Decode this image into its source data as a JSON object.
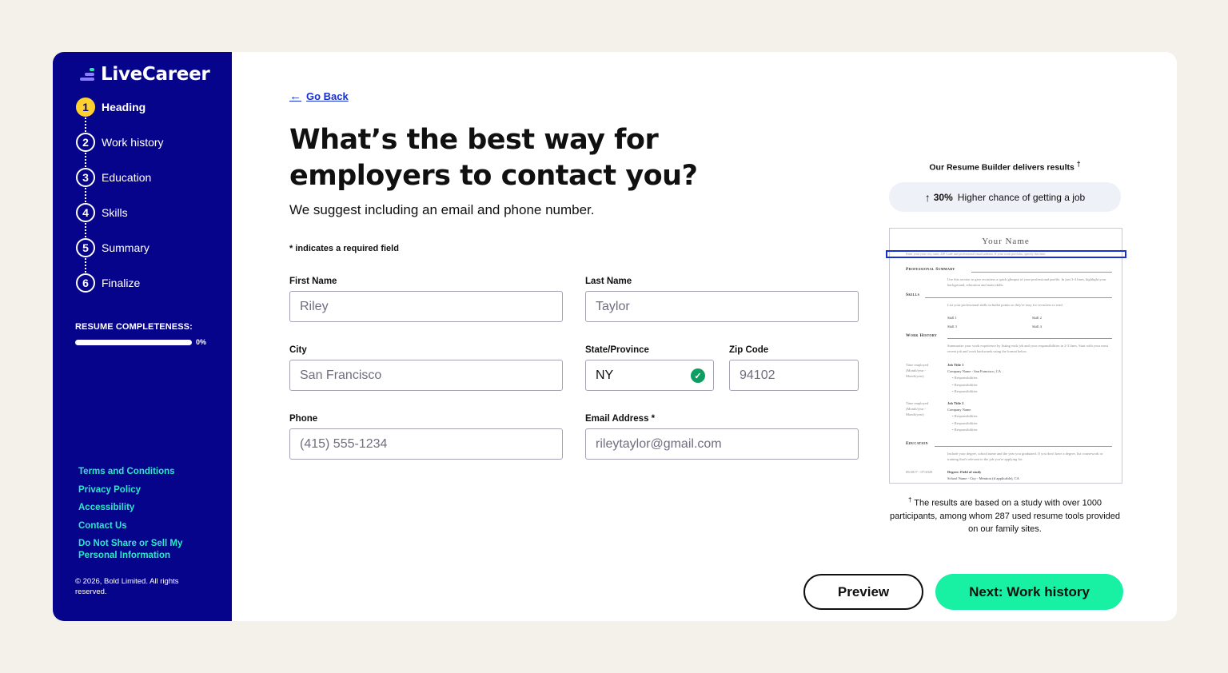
{
  "brand": {
    "name": "LiveCareer",
    "accent": "#2ce8a8",
    "sidebar_bg": "#07048c",
    "active_step_color": "#ffd12e"
  },
  "steps": [
    {
      "num": "1",
      "label": "Heading",
      "active": true
    },
    {
      "num": "2",
      "label": "Work history",
      "active": false
    },
    {
      "num": "3",
      "label": "Education",
      "active": false
    },
    {
      "num": "4",
      "label": "Skills",
      "active": false
    },
    {
      "num": "5",
      "label": "Summary",
      "active": false
    },
    {
      "num": "6",
      "label": "Finalize",
      "active": false
    }
  ],
  "completeness": {
    "label": "RESUME COMPLETENESS:",
    "value_pct": "0%",
    "value": 0
  },
  "footer": {
    "links": [
      "Terms and Conditions",
      "Privacy Policy",
      "Accessibility",
      "Contact Us",
      "Do Not Share or Sell My Personal Information"
    ],
    "copyright": "© 2026, Bold Limited. All rights reserved."
  },
  "nav": {
    "go_back": "Go Back"
  },
  "page": {
    "title": "What’s the best way for employers to contact you?",
    "subtitle": "We suggest including an email and phone number.",
    "required_note": "* indicates a required field"
  },
  "form": {
    "first_name": {
      "label": "First Name",
      "placeholder": "Riley"
    },
    "last_name": {
      "label": "Last Name",
      "placeholder": "Taylor"
    },
    "city": {
      "label": "City",
      "placeholder": "San Francisco"
    },
    "state": {
      "label": "State/Province",
      "value": "NY",
      "valid_icon": "check-circle-icon"
    },
    "zip": {
      "label": "Zip Code",
      "placeholder": "94102"
    },
    "phone": {
      "label": "Phone",
      "placeholder": "(415) 555-1234"
    },
    "email": {
      "label": "Email Address *",
      "placeholder": "rileytaylor@gmail.com"
    }
  },
  "results": {
    "title": "Our Resume Builder delivers results",
    "dagger": "†",
    "stat_value": "30%",
    "stat_text": "Higher chance of getting a job",
    "footnote": "The results are based on a study with over 1000 participants, among whom 287 used resume tools provided on our family sites."
  },
  "resume_preview": {
    "name": "Your Name",
    "contact": "Enter your your city, state, ZIP Code and professional email address. If your work portfolio, specify this here.",
    "sections": {
      "summary": "Professional Summary",
      "skills": "Skills",
      "work": "Work History",
      "education": "Education"
    },
    "summary_text": "Use this section to give recruiters a quick glimpse of your professional profile. In just 3-4 lines, highlight your background, education and main skills.",
    "skills_text": "List your professional skills in bullet points so they're easy for recruiters to read.",
    "skills": [
      "Skill 1",
      "Skill 2",
      "Skill 3",
      "Skill 4"
    ],
    "work_text": "Summarize your work experience by listing each job and your responsibilities in 2-3 lines. Start with your most recent job and work backwards using the format below.",
    "jobs": [
      {
        "dates": "Time employed (Month/year - Month/year)",
        "title": "Job Title 1",
        "company": "Company Name - San Francisco, CA",
        "items": [
          "Responsibilities",
          "Responsibilities",
          "Responsibilities"
        ]
      },
      {
        "dates": "Time employed (Month/year - Month/year)",
        "title": "Job Title 2",
        "company": "Company Name",
        "items": [
          "Responsibilities",
          "Responsibilities",
          "Responsibilities"
        ]
      }
    ],
    "education_text": "Include your degree, school name and the year you graduated. If you don't have a degree, list coursework or training that's relevant to the job you're applying for.",
    "edu_dates": "09/2017 - 07/2020",
    "edu_degree": "Degree: Field of study",
    "edu_school": "School Name - City - Mention (if applicable), CA"
  },
  "buttons": {
    "preview": "Preview",
    "next": "Next: Work history"
  }
}
